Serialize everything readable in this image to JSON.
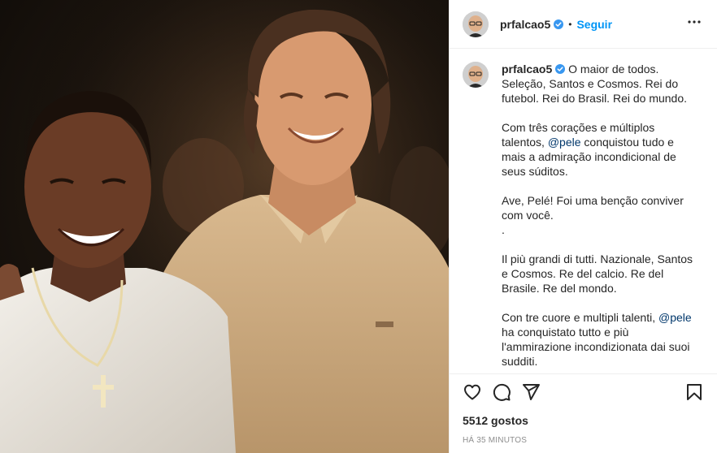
{
  "post": {
    "image_alt": "Foto de dois homens sorrindo lado a lado"
  },
  "header": {
    "username": "prfalcao5",
    "separator": "•",
    "follow_label": "Seguir",
    "more_icon": "more-horizontal-icon",
    "verified_icon": "verified-badge-icon"
  },
  "caption": {
    "username": "prfalcao5",
    "p1": "O maior de todos. Seleção, Santos e Cosmos. Rei do futebol. Rei do Brasil. Rei do mundo.",
    "p2_before": "Com três corações e múltiplos talentos, ",
    "mention": "@pele",
    "p2_after": " conquistou tudo e mais a admiração incondicional de seus súditos.",
    "p3": "Ave, Pelé! Foi uma benção conviver com você.",
    "p3_dot": ".",
    "p4": "Il più grandi di tutti. Nazionale, Santos e Cosmos. Re del calcio. Re del Brasile. Re del mondo.",
    "p5_before": "Con tre cuore e multipli talenti, ",
    "p5_mention": "@pele",
    "p5_after": " ha conquistato tutto e più l'ammirazione incondizionata dai suoi sudditi."
  },
  "actions": {
    "like_icon": "heart-icon",
    "comment_icon": "comment-icon",
    "share_icon": "paper-plane-icon",
    "save_icon": "bookmark-icon"
  },
  "likes_label": "5512 gostos",
  "timestamp": "HÁ 35 MINUTOS",
  "colors": {
    "link_blue": "#0095f6",
    "mention": "#00376b",
    "text": "#262626",
    "muted": "#8e8e8e",
    "verified": "#3897f0"
  }
}
